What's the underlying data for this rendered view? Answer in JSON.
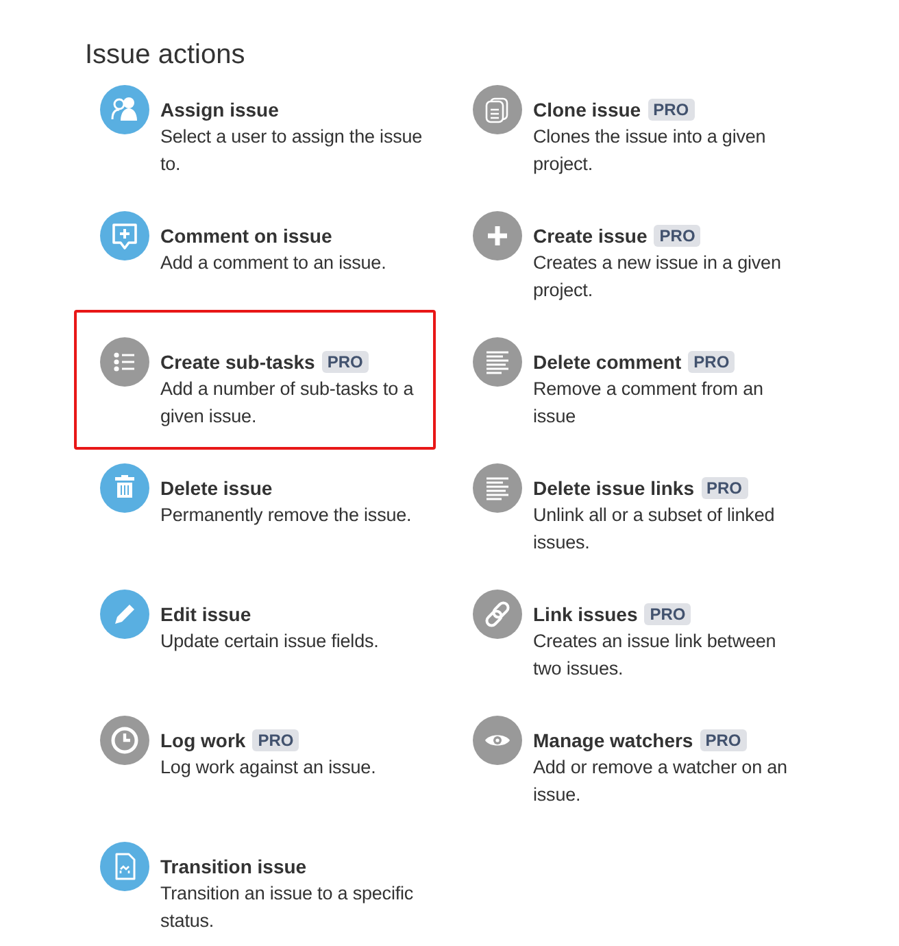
{
  "title": "Issue actions",
  "actions": [
    {
      "kind": "assign",
      "name": "Assign issue",
      "pro": false,
      "highlighted": false,
      "description": "Select a user to assign the issue to."
    },
    {
      "kind": "clone",
      "name": "Clone issue",
      "pro": true,
      "badge": "PRO",
      "highlighted": false,
      "description": "Clones the issue into a given project."
    },
    {
      "kind": "comment",
      "name": "Comment on issue",
      "pro": false,
      "highlighted": false,
      "description": "Add a comment to an issue."
    },
    {
      "kind": "create",
      "name": "Create issue",
      "pro": true,
      "badge": "PRO",
      "highlighted": false,
      "description": "Creates a new issue in a given project."
    },
    {
      "kind": "subtasks",
      "name": "Create sub-tasks",
      "pro": true,
      "badge": "PRO",
      "highlighted": true,
      "description": "Add a number of sub-tasks to a given issue."
    },
    {
      "kind": "lines",
      "name": "Delete comment",
      "pro": true,
      "badge": "PRO",
      "highlighted": false,
      "description": "Remove a comment from an issue"
    },
    {
      "kind": "delete",
      "name": "Delete issue",
      "pro": false,
      "highlighted": false,
      "description": "Permanently remove the issue."
    },
    {
      "kind": "lines",
      "name": "Delete issue links",
      "pro": true,
      "badge": "PRO",
      "highlighted": false,
      "description": "Unlink all or a subset of linked issues."
    },
    {
      "kind": "edit",
      "name": "Edit issue",
      "pro": false,
      "highlighted": false,
      "description": "Update certain issue fields."
    },
    {
      "kind": "link",
      "name": "Link issues",
      "pro": true,
      "badge": "PRO",
      "highlighted": false,
      "description": "Creates an issue link between two issues."
    },
    {
      "kind": "log",
      "name": "Log work",
      "pro": true,
      "badge": "PRO",
      "highlighted": false,
      "description": "Log work against an issue."
    },
    {
      "kind": "watch",
      "name": "Manage watchers",
      "pro": true,
      "badge": "PRO",
      "highlighted": false,
      "description": "Add or remove a watcher on an issue."
    },
    {
      "kind": "transition",
      "name": "Transition issue",
      "pro": false,
      "highlighted": false,
      "description": "Transition an issue to a specific status."
    }
  ]
}
